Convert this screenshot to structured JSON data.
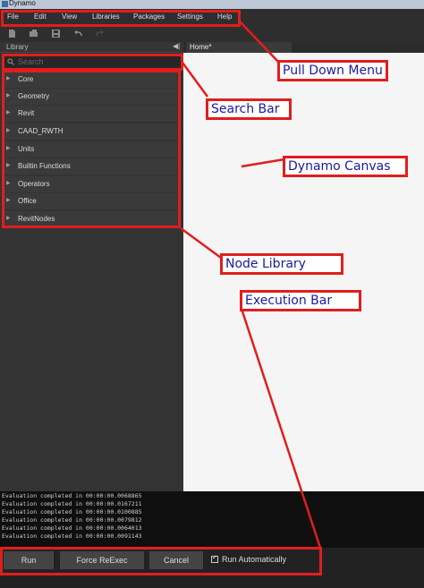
{
  "window": {
    "title": "Dynamo"
  },
  "menu": {
    "items": [
      "File",
      "Edit",
      "View",
      "Libraries",
      "Packages",
      "Settings",
      "Help"
    ]
  },
  "toolbar": {
    "icons": [
      "new-file-icon",
      "open-icon",
      "save-icon",
      "undo-icon",
      "redo-icon"
    ]
  },
  "library": {
    "header": "Library",
    "collapse_glyph": "◀|",
    "search_placeholder": "Search",
    "categories": [
      "Core",
      "Geometry",
      "Revit",
      "CAAD_RWTH",
      "Units",
      "Builtin Functions",
      "Operators",
      "Office",
      "RevitNodes"
    ]
  },
  "tabs": {
    "home": "Home*"
  },
  "console": {
    "lines": [
      "Evaluation completed in 00:00:00.0068865",
      "Evaluation completed in 00:00:00.0167211",
      "Evaluation completed in 00:00:00.0100885",
      "Evaluation completed in 00:00:00.0079812",
      "Evaluation completed in 00:00:00.0064013",
      "Evaluation completed in 00:00:00.0091143"
    ]
  },
  "execution": {
    "run": "Run",
    "force": "Force ReExec",
    "cancel": "Cancel",
    "auto": "Run Automatically",
    "auto_checked": true
  },
  "annotations": {
    "menu": "Pull Down Menu",
    "search": "Search Bar",
    "canvas": "Dynamo Canvas",
    "library": "Node Library",
    "execbar": "Execution Bar"
  },
  "annotation_color": "#e01e1e"
}
